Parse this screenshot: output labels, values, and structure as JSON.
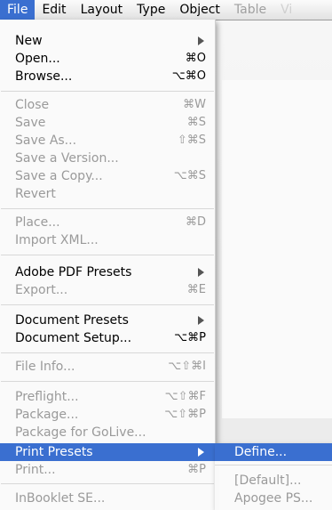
{
  "menubar": {
    "items": [
      {
        "label": "File"
      },
      {
        "label": "Edit"
      },
      {
        "label": "Layout"
      },
      {
        "label": "Type"
      },
      {
        "label": "Object"
      },
      {
        "label": "Table"
      },
      {
        "label": "Vi"
      }
    ]
  },
  "file_menu": {
    "items": [
      {
        "label": "New",
        "shortcut": "",
        "submenu": true,
        "enabled": true
      },
      {
        "label": "Open...",
        "shortcut": "⌘O",
        "enabled": true
      },
      {
        "label": "Browse...",
        "shortcut": "⌥⌘O",
        "enabled": true
      },
      {
        "label": "Close",
        "shortcut": "⌘W",
        "enabled": false
      },
      {
        "label": "Save",
        "shortcut": "⌘S",
        "enabled": false
      },
      {
        "label": "Save As...",
        "shortcut": "⇧⌘S",
        "enabled": false
      },
      {
        "label": "Save a Version...",
        "shortcut": "",
        "enabled": false
      },
      {
        "label": "Save a Copy...",
        "shortcut": "⌥⌘S",
        "enabled": false
      },
      {
        "label": "Revert",
        "shortcut": "",
        "enabled": false
      },
      {
        "label": "Place...",
        "shortcut": "⌘D",
        "enabled": false
      },
      {
        "label": "Import XML...",
        "shortcut": "",
        "enabled": false
      },
      {
        "label": "Adobe PDF Presets",
        "shortcut": "",
        "submenu": true,
        "enabled": true
      },
      {
        "label": "Export...",
        "shortcut": "⌘E",
        "enabled": false
      },
      {
        "label": "Document Presets",
        "shortcut": "",
        "submenu": true,
        "enabled": true
      },
      {
        "label": "Document Setup...",
        "shortcut": "⌥⌘P",
        "enabled": true
      },
      {
        "label": "File Info...",
        "shortcut": "⌥⇧⌘I",
        "enabled": false
      },
      {
        "label": "Preflight...",
        "shortcut": "⌥⇧⌘F",
        "enabled": false
      },
      {
        "label": "Package...",
        "shortcut": "⌥⇧⌘P",
        "enabled": false
      },
      {
        "label": "Package for GoLive...",
        "shortcut": "",
        "enabled": false
      },
      {
        "label": "Print Presets",
        "shortcut": "",
        "submenu": true,
        "enabled": true,
        "selected": true
      },
      {
        "label": "Print...",
        "shortcut": "⌘P",
        "enabled": false
      },
      {
        "label": "InBooklet SE...",
        "shortcut": "",
        "enabled": false
      }
    ]
  },
  "print_presets_submenu": {
    "items": [
      {
        "label": "Define...",
        "selected": true
      },
      {
        "label": "[Default]...",
        "enabled": false
      },
      {
        "label": "Apogee PS...",
        "enabled": false
      }
    ]
  },
  "colors": {
    "highlight": "#3a6fd0",
    "disabled_text": "#9a9a9a"
  }
}
